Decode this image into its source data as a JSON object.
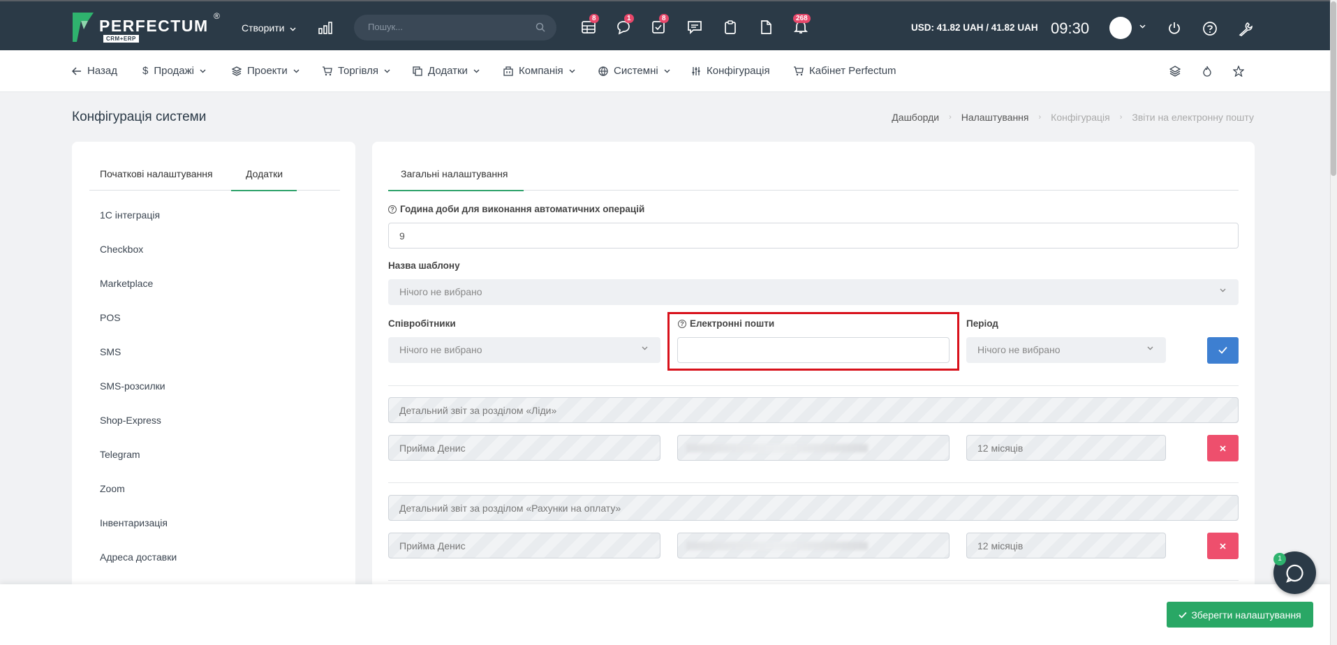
{
  "topbar": {
    "brand": "PERFECTUM",
    "brand_sub": "CRM+ERP",
    "brand_reg": "®",
    "create_label": "Створити",
    "search_placeholder": "Пошук...",
    "badges": {
      "tasks_table": "8",
      "chat": "1",
      "todo": "8",
      "notifications": "268"
    },
    "currency": "USD: 41.82 UAH / 41.82 UAH",
    "time": "09:30"
  },
  "nav": {
    "back": "Назад",
    "sales": "Продажі",
    "projects": "Проекти",
    "trade": "Торгівля",
    "addons": "Додатки",
    "company": "Компанія",
    "system": "Системні",
    "config": "Конфігурація",
    "cabinet": "Кабінет Perfectum"
  },
  "page": {
    "title": "Конфігурація системи",
    "breadcrumbs": [
      "Дашборди",
      "Налаштування",
      "Конфігурація",
      "Звіти на електронну пошту"
    ]
  },
  "sidebar": {
    "tabs": [
      "Початкові налаштування",
      "Додатки"
    ],
    "items": [
      "1С інтеграція",
      "Checkbox",
      "Marketplace",
      "POS",
      "SMS",
      "SMS-розсилки",
      "Shop-Express",
      "Telegram",
      "Zoom",
      "Інвентаризація",
      "Адреса доставки"
    ]
  },
  "main": {
    "tab": "Загальні налаштування",
    "hour_label": "Година доби для виконання автоматичних операцій",
    "hour_value": "9",
    "template_label": "Назва шаблону",
    "template_value": "Нічого не вибрано",
    "employees_label": "Співробітники",
    "employees_value": "Нічого не вибрано",
    "emails_label": "Електронні пошти",
    "emails_value": "",
    "period_label": "Період",
    "period_value": "Нічого не вибрано",
    "reports": [
      {
        "title": "Детальний звіт за розділом «Ліди»",
        "employee": "Прийма Денис",
        "period": "12 місяців"
      },
      {
        "title": "Детальний звіт за розділом «Рахунки на оплату»",
        "employee": "Прийма Денис",
        "period": "12 місяців"
      }
    ]
  },
  "footer": {
    "save_label": "Зберегти налаштування",
    "chat_badge": "1"
  },
  "colors": {
    "topbar": "#2b3a47",
    "accent_green": "#2fa36b",
    "primary_blue": "#3d7fd1",
    "danger": "#ee4f6d",
    "highlight": "#d8101a"
  }
}
